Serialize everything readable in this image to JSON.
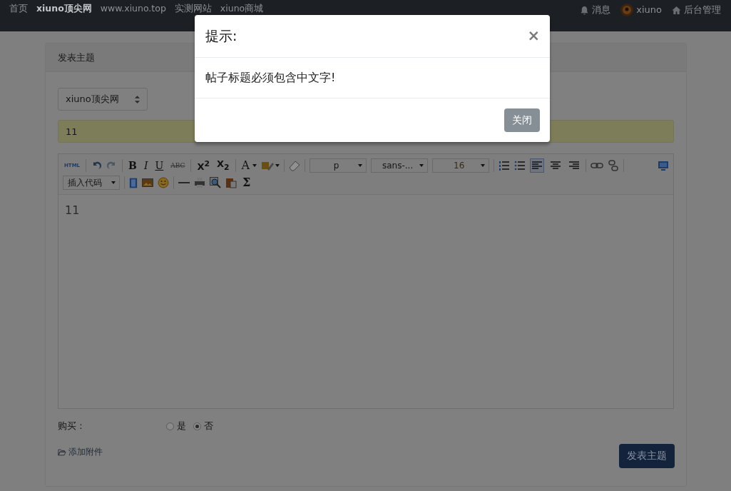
{
  "navbar": {
    "links": [
      {
        "label": "首页",
        "selected": false
      },
      {
        "label": "xiuno顶尖网",
        "selected": true
      },
      {
        "label": "www.xiuno.top",
        "selected": false
      },
      {
        "label": "实测网站",
        "selected": false
      },
      {
        "label": "xiuno商城",
        "selected": false
      }
    ],
    "right": {
      "messages": "消息",
      "user": "xiuno",
      "admin": "后台管理"
    }
  },
  "card": {
    "title": "发表主题",
    "category": "xiuno顶尖网",
    "subject": "11",
    "editor": {
      "html": "HTML",
      "letters": [
        "B",
        "I",
        "U",
        "ABC"
      ],
      "scripts": [
        "X$^{2}$",
        "X$_{2}$"
      ],
      "font_color": "A",
      "paragraph": "p",
      "font_family": "sans-...",
      "font_size": "16",
      "alignment": [
        {
          "selected": true
        },
        {
          "selected": false
        },
        {
          "selected": false
        }
      ],
      "insert_code": "插入代码",
      "formula": "Σ",
      "content": "11"
    },
    "purchase": {
      "label": "购买 :",
      "options": [
        {
          "label": "是",
          "selected": false
        },
        {
          "label": "否",
          "selected": true
        }
      ]
    },
    "attach": "添加附件",
    "submit": "发表主题"
  },
  "modal": {
    "title": "提示:",
    "close": "×",
    "message": "帖子标题必须包含中文字!",
    "button": "关闭"
  }
}
